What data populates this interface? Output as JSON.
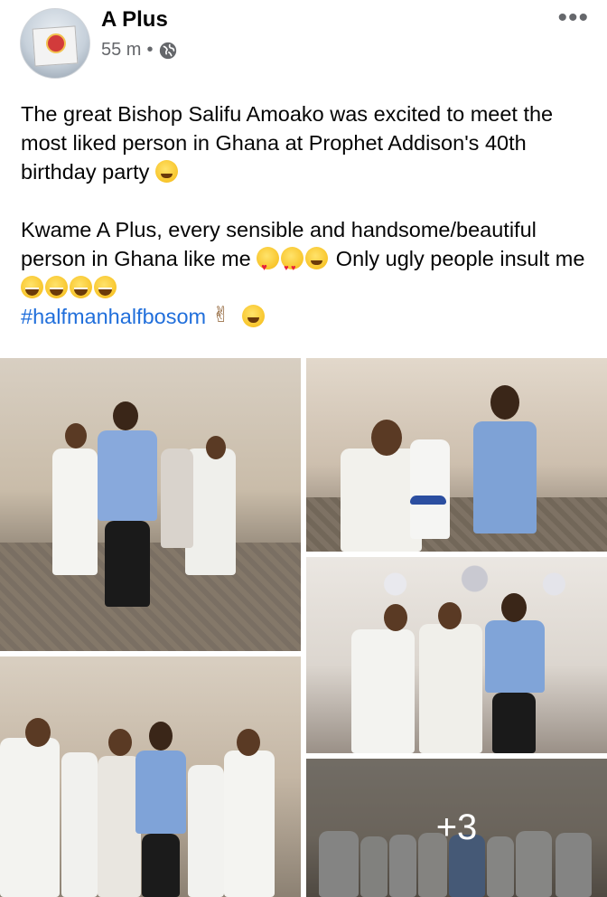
{
  "post": {
    "author": "A Plus",
    "time": "55 m",
    "separator": "•",
    "privacy_icon": "globe-icon",
    "more_icon": "more-icon",
    "more_label": "•••"
  },
  "text": {
    "para1": "The great Bishop Salifu Amoako was excited to meet the most liked person in Ghana at Prophet Addison's 40th birthday party",
    "para2_line": "Kwame A Plus, every sensible and handsome/beautiful person in Ghana like me",
    "para2_tail": "Only ugly people insult me",
    "hashtag": "#halfmanhalfbosom"
  },
  "gallery": {
    "more_count": "+3",
    "colors": {
      "wall": "#cbbfae",
      "floor": "#8a7f72",
      "blue_suit": "#7fa3d8",
      "white_cloth": "#f2f2ef"
    }
  }
}
